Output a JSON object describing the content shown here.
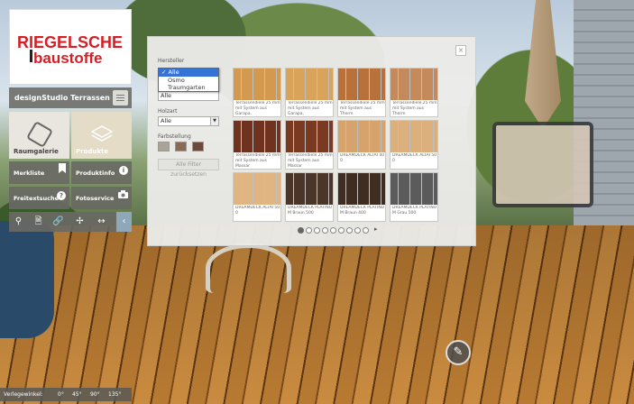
{
  "colors": {
    "accent_red": "#d41f26",
    "panel_bg": "#787873",
    "back_button": "#8fa8b9",
    "select_highlight": "#3574d6"
  },
  "logo": {
    "line1": "RIEGELSCHE",
    "line2": "baustoffe"
  },
  "studio": {
    "title": "designStudio Terrassen",
    "menu_icon": "hamburger-icon"
  },
  "tiles": {
    "raumgalerie": "Raumgalerie",
    "produkte": "Produkte"
  },
  "buttons": {
    "merkliste": "Merkliste",
    "produktinfo": "Produktinfo",
    "freitextsuche": "Freitextsuche",
    "fotoservice": "Fotoservice"
  },
  "toolbar": [
    "search-icon",
    "document-icon",
    "link-icon",
    "move-icon",
    "arrows-horizontal-icon",
    "back-icon"
  ],
  "filters": {
    "hersteller_label": "Hersteller",
    "hersteller_value": "Alle",
    "hersteller_options": [
      "Alle",
      "Osmo",
      "Traumgarten"
    ],
    "holzart_label": "Holzart",
    "holzart_value": "Alle",
    "second_select_value": "Alle",
    "farbstellung_label": "Farbstellung",
    "swatches": [
      "#a9a39a",
      "#8a6a54",
      "#6b4a3c"
    ],
    "reset_label": "Alle Filter zurücksetzen"
  },
  "products": [
    {
      "label": "Terrassendiele 25 mm mit System aus Garapa,",
      "color": "#d2994f"
    },
    {
      "label": "Terrassendiele 25 mm mit System aus Garapa,",
      "color": "#d9a35a"
    },
    {
      "label": "Terrassendiele 25 mm mit System aus Therm",
      "color": "#b9713c"
    },
    {
      "label": "Terrassendiele 25 mm mit System aus Therm",
      "color": "#c58a5c"
    },
    {
      "label": "Terrassendiele 25 mm mit System aus Massar",
      "color": "#6f321e"
    },
    {
      "label": "Terrassendiele 25 mm mit System aus Massar",
      "color": "#7a3a22"
    },
    {
      "label": "DREAMDECK ALTAI 40 0",
      "color": "#d5a36b"
    },
    {
      "label": "DREAMDECK ALTAI 50 0",
      "color": "#dcb07c"
    },
    {
      "label": "DREAMDECK ALTAI 50 0",
      "color": "#e1b582"
    },
    {
      "label": "DREAMDECK PLATINU M Braun 500",
      "color": "#4a3528"
    },
    {
      "label": "DREAMDECK PLATINU M Braun 400",
      "color": "#3f2d22"
    },
    {
      "label": "DREAMDECK PLATINU M Grau 500",
      "color": "#5b5b5b"
    }
  ],
  "pager": {
    "pages": 9,
    "current": 1
  },
  "angles": {
    "label": "Verlegewinkel:",
    "values": [
      "0°",
      "45°",
      "90°",
      "135°"
    ]
  },
  "close_label": "×",
  "edit_icon": "pencil-icon"
}
